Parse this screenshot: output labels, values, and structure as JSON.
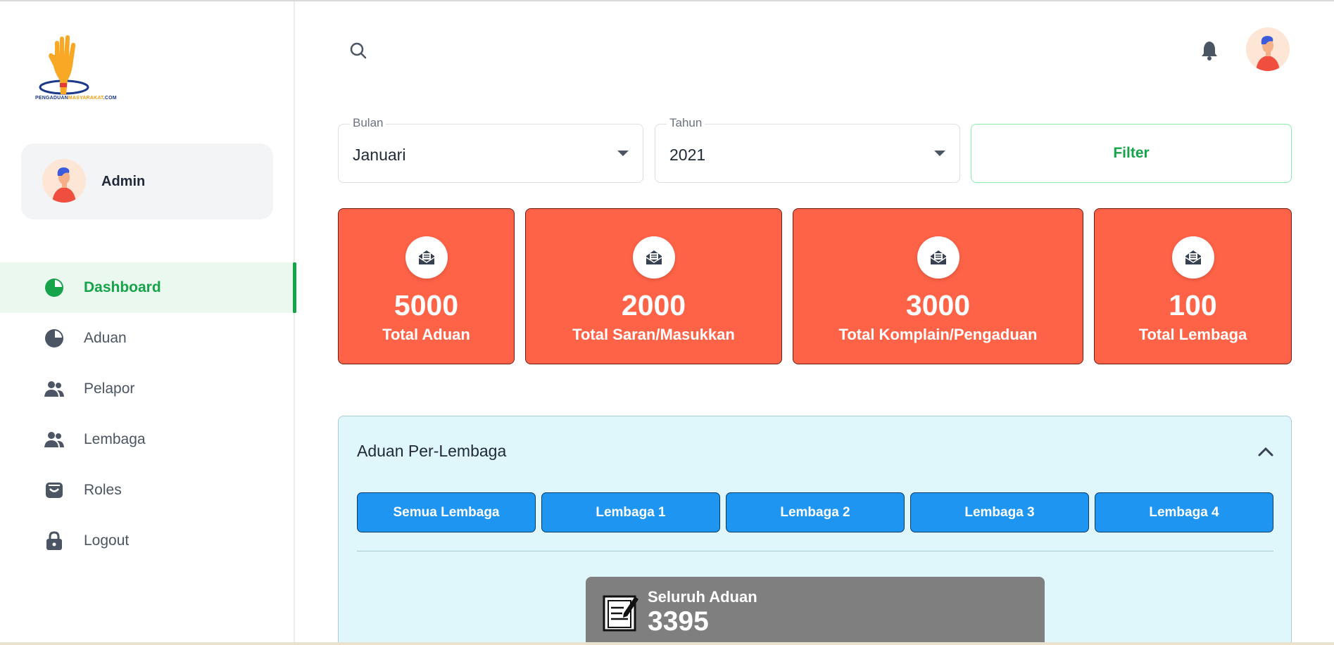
{
  "brand": {
    "logo_text_part1": "PENGADUAN",
    "logo_text_part2": "MASYARAKAT",
    "logo_text_part3": ".COM",
    "accent": "#16a34a",
    "card_color": "#ff6347",
    "tab_color": "#1f95f2"
  },
  "user": {
    "name": "Admin"
  },
  "sidebar": {
    "items": [
      {
        "label": "Dashboard",
        "icon": "pie-chart-icon",
        "active": true
      },
      {
        "label": "Aduan",
        "icon": "pie-chart-icon",
        "active": false
      },
      {
        "label": "Pelapor",
        "icon": "users-icon",
        "active": false
      },
      {
        "label": "Lembaga",
        "icon": "users-icon",
        "active": false
      },
      {
        "label": "Roles",
        "icon": "inbox-icon",
        "active": false
      },
      {
        "label": "Logout",
        "icon": "lock-icon",
        "active": false
      }
    ]
  },
  "header": {
    "search_icon": "search-icon",
    "bell_icon": "bell-icon"
  },
  "filters": {
    "month": {
      "legend": "Bulan",
      "value": "Januari"
    },
    "year": {
      "legend": "Tahun",
      "value": "2021"
    },
    "filter_label": "Filter"
  },
  "stats": [
    {
      "value": "5000",
      "label": "Total Aduan",
      "icon": "mail-open-icon"
    },
    {
      "value": "2000",
      "label": "Total Saran/Masukkan",
      "icon": "mail-open-icon"
    },
    {
      "value": "3000",
      "label": "Total Komplain/Pengaduan",
      "icon": "mail-open-icon"
    },
    {
      "value": "100",
      "label": "Total Lembaga",
      "icon": "mail-open-icon"
    }
  ],
  "panel": {
    "title": "Aduan Per-Lembaga",
    "tabs": [
      "Semua Lembaga",
      "Lembaga 1",
      "Lembaga 2",
      "Lembaga 3",
      "Lembaga 4"
    ],
    "summary": {
      "title": "Seluruh Aduan",
      "value": "3395",
      "icon": "note-edit-icon"
    }
  }
}
